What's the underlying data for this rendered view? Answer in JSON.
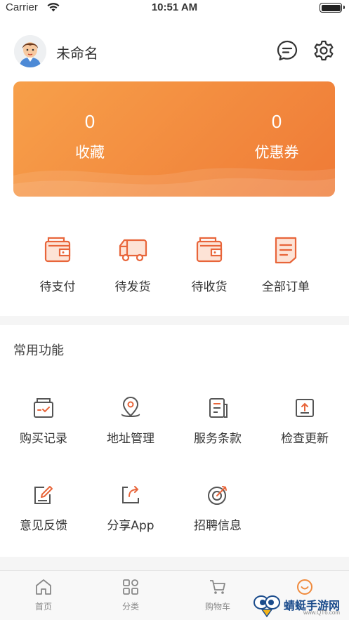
{
  "status_bar": {
    "carrier": "Carrier",
    "time": "10:51 AM"
  },
  "header": {
    "username": "未命名",
    "avatar": "avatar",
    "icons": [
      "message-icon",
      "gear-icon"
    ]
  },
  "stats_card": {
    "favorites": {
      "count": "0",
      "label": "收藏"
    },
    "coupons": {
      "count": "0",
      "label": "优惠券"
    }
  },
  "orders": [
    {
      "label": "待支付",
      "icon": "wallet-icon"
    },
    {
      "label": "待发货",
      "icon": "truck-icon"
    },
    {
      "label": "待收货",
      "icon": "package-icon"
    },
    {
      "label": "全部订单",
      "icon": "document-icon"
    }
  ],
  "common_functions": {
    "title": "常用功能",
    "items": [
      {
        "label": "购买记录",
        "icon": "purchase-record-icon"
      },
      {
        "label": "地址管理",
        "icon": "location-pin-icon"
      },
      {
        "label": "服务条款",
        "icon": "terms-icon"
      },
      {
        "label": "检查更新",
        "icon": "upload-icon"
      },
      {
        "label": "意见反馈",
        "icon": "feedback-icon"
      },
      {
        "label": "分享App",
        "icon": "share-icon"
      },
      {
        "label": "招聘信息",
        "icon": "target-icon"
      }
    ]
  },
  "tabbar": [
    {
      "label": "首页",
      "icon": "home-icon",
      "active": false
    },
    {
      "label": "分类",
      "icon": "grid-icon",
      "active": false
    },
    {
      "label": "购物车",
      "icon": "cart-icon",
      "active": false
    },
    {
      "label": "",
      "icon": "smile-icon",
      "active": true
    }
  ],
  "watermark": {
    "text": "蜻蜓手游网",
    "sub": "www.QT6.com"
  },
  "colors": {
    "accent": "#f08a3c",
    "card_start": "#f7a04a",
    "card_end": "#ef7a36",
    "icon_orange": "#e8653a",
    "icon_gray": "#555555"
  }
}
